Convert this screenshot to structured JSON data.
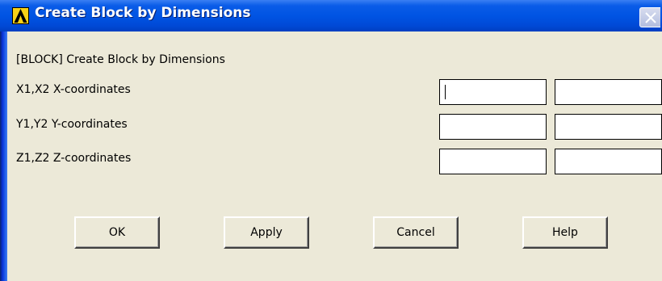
{
  "window": {
    "title": "Create Block by Dimensions"
  },
  "dialog": {
    "heading": "[BLOCK]  Create Block by Dimensions",
    "rows": [
      {
        "label": "X1,X2  X-coordinates",
        "value1": "",
        "value2": ""
      },
      {
        "label": "Y1,Y2  Y-coordinates",
        "value1": "",
        "value2": ""
      },
      {
        "label": "Z1,Z2  Z-coordinates",
        "value1": "",
        "value2": ""
      }
    ]
  },
  "buttons": {
    "ok": "OK",
    "apply": "Apply",
    "cancel": "Cancel",
    "help": "Help"
  },
  "icons": {
    "app": "ansys-logo-icon",
    "close": "close-icon"
  },
  "colors": {
    "titlebar": "#0054e3",
    "dialog_bg": "#ece9d8",
    "app_icon": "#f7d117"
  }
}
